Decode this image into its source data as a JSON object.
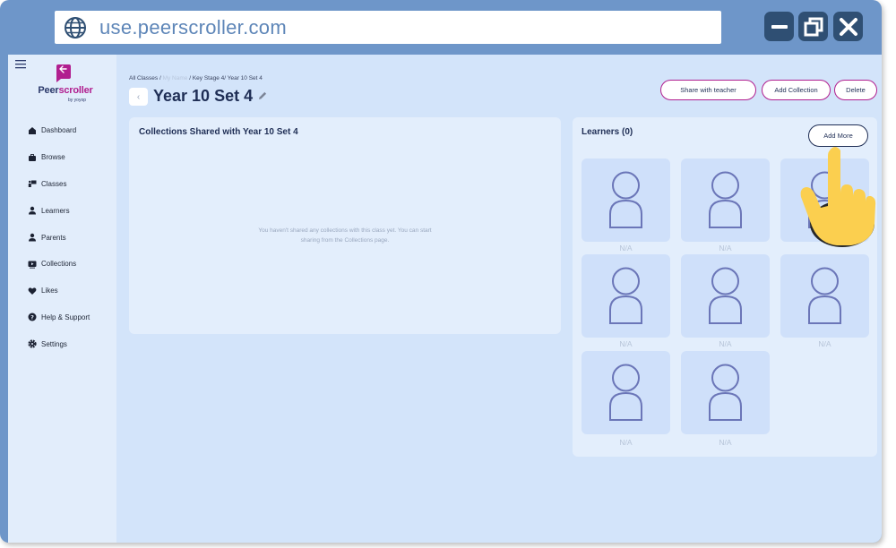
{
  "browser": {
    "url": "use.peerscroller.com",
    "controls": {
      "minimize_icon": "minimize-icon",
      "maximize_icon": "restore-icon",
      "close_icon": "close-icon"
    }
  },
  "brand": {
    "name_part1": "Peer",
    "name_part2": "scroller",
    "byline": "by yoyop",
    "colors": {
      "primary": "#1f2e55",
      "accent": "#b11f8f",
      "background": "#d3e4fa",
      "frame": "#6e96c9"
    }
  },
  "sidebar": {
    "items": [
      {
        "label": "Dashboard",
        "icon": "home-icon"
      },
      {
        "label": "Browse",
        "icon": "briefcase-icon"
      },
      {
        "label": "Classes",
        "icon": "classes-icon"
      },
      {
        "label": "Learners",
        "icon": "person-icon"
      },
      {
        "label": "Parents",
        "icon": "person-icon"
      },
      {
        "label": "Collections",
        "icon": "collection-icon"
      },
      {
        "label": "Likes",
        "icon": "heart-icon"
      },
      {
        "label": "Help & Support",
        "icon": "help-icon"
      },
      {
        "label": "Settings",
        "icon": "gear-icon"
      }
    ]
  },
  "header": {
    "breadcrumb": {
      "part1": "All Classes /",
      "part2": "My Name",
      "part3": "/ Key Stage 4/ Year 10 Set 4"
    },
    "back_symbol": "‹",
    "title": "Year 10 Set 4",
    "buttons": {
      "share": "Share with teacher",
      "add_collection": "Add Collection",
      "delete": "Delete"
    }
  },
  "collections_panel": {
    "heading": "Collections Shared with Year 10 Set 4",
    "empty_line1": "You haven't shared any collections with this class yet. You can start",
    "empty_line2": "sharing from the Collections page."
  },
  "learners_panel": {
    "heading": "Learners (0)",
    "add_more": "Add More",
    "learners": [
      "N/A",
      "N/A",
      "N/A",
      "N/A",
      "N/A",
      "N/A",
      "N/A",
      "N/A"
    ]
  }
}
